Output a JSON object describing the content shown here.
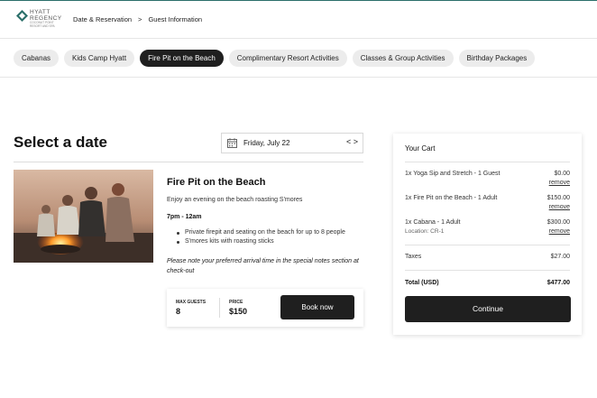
{
  "header": {
    "logo": {
      "line1": "HYATT",
      "line2": "REGENCY",
      "line3": "COCONUT POINT RESORT AND SPA"
    },
    "breadcrumb": [
      "Date & Reservation",
      ">",
      "Guest Information"
    ]
  },
  "tabs": [
    {
      "label": "Cabanas",
      "active": false
    },
    {
      "label": "Kids Camp Hyatt",
      "active": false
    },
    {
      "label": "Fire Pit on the Beach",
      "active": true
    },
    {
      "label": "Complimentary Resort Activities",
      "active": false
    },
    {
      "label": "Classes & Group Activities",
      "active": false
    },
    {
      "label": "Birthday Packages",
      "active": false
    }
  ],
  "main": {
    "title": "Select a date",
    "date_picker": {
      "date": "Friday, July 22",
      "prev": "<",
      "next": ">"
    },
    "event": {
      "title": "Fire Pit on the Beach",
      "description": "Enjoy an evening on the beach roasting S'mores",
      "time": "7pm - 12am",
      "features": [
        "Private firepit and seating on the beach for up to 8 people",
        "S'mores kits with roasting sticks"
      ],
      "note": "Please note your preferred arrival time in the special notes section at check-out"
    },
    "booking": {
      "max_guests_label": "MAX GUESTS",
      "max_guests": "8",
      "price_label": "PRICE",
      "price": "$150",
      "book_label": "Book now"
    }
  },
  "cart": {
    "title": "Your Cart",
    "items": [
      {
        "name": "1x Yoga Sip and Stretch - 1 Guest",
        "location": "",
        "price": "$0.00",
        "remove": "remove"
      },
      {
        "name": "1x Fire Pit on the Beach - 1 Adult",
        "location": "",
        "price": "$150.00",
        "remove": "remove"
      },
      {
        "name": "1x Cabana - 1 Adult",
        "location": "Location: CR-1",
        "price": "$300.00",
        "remove": "remove"
      }
    ],
    "taxes_label": "Taxes",
    "taxes": "$27.00",
    "total_label": "Total (USD)",
    "total": "$477.00",
    "continue_label": "Continue"
  },
  "colors": {
    "accent": "#1f1f1f",
    "brand": "#2b6f6a"
  },
  "icons": {
    "logo": "hyatt-logo-icon",
    "calendar": "calendar-icon",
    "prev": "chevron-left-icon",
    "next": "chevron-right-icon"
  }
}
